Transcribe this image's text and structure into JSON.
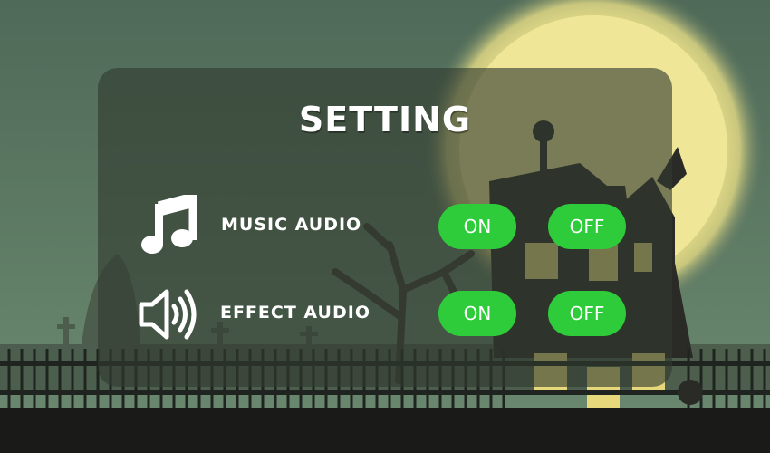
{
  "title": "SETTING",
  "rows": [
    {
      "label": "MUSIC AUDIO",
      "icon": "music-note-icon",
      "on_label": "ON",
      "off_label": "OFF"
    },
    {
      "label": "EFFECT AUDIO",
      "icon": "speaker-icon",
      "on_label": "ON",
      "off_label": "OFF"
    }
  ],
  "colors": {
    "toggle_green": "#2ecc3a",
    "moon": "#f2e79a",
    "sky": "#55705e"
  }
}
